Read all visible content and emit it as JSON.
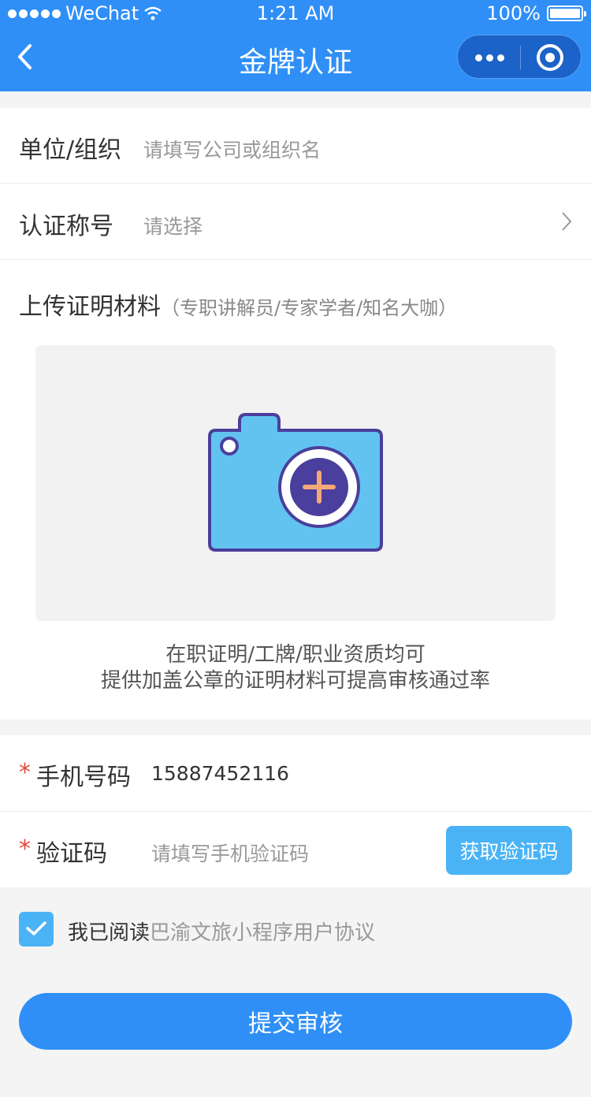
{
  "status_bar": {
    "carrier": "WeChat",
    "time": "1:21 AM",
    "battery": "100%"
  },
  "nav": {
    "title": "金牌认证"
  },
  "form": {
    "org": {
      "label": "单位/组织",
      "placeholder": "请填写公司或组织名"
    },
    "title_select": {
      "label": "认证称号",
      "placeholder": "请选择"
    },
    "upload": {
      "label": "上传证明材料",
      "sub": "（专职讲解员/专家学者/知名大咖）",
      "hint_line1": "在职证明/工牌/职业资质均可",
      "hint_line2": "提供加盖公章的证明材料可提高审核通过率"
    },
    "phone": {
      "required_mark": "*",
      "label": "手机号码",
      "value": "15887452116"
    },
    "code": {
      "required_mark": "*",
      "label": "验证码",
      "placeholder": "请填写手机验证码",
      "button": "获取验证码"
    }
  },
  "agreement": {
    "checked": true,
    "prefix": "我已阅读",
    "link": "巴渝文旅小程序用户协议"
  },
  "submit": {
    "label": "提交审核"
  },
  "colors": {
    "primary": "#2f8ff7",
    "accent": "#4ab3f6",
    "required": "#e8463b"
  }
}
